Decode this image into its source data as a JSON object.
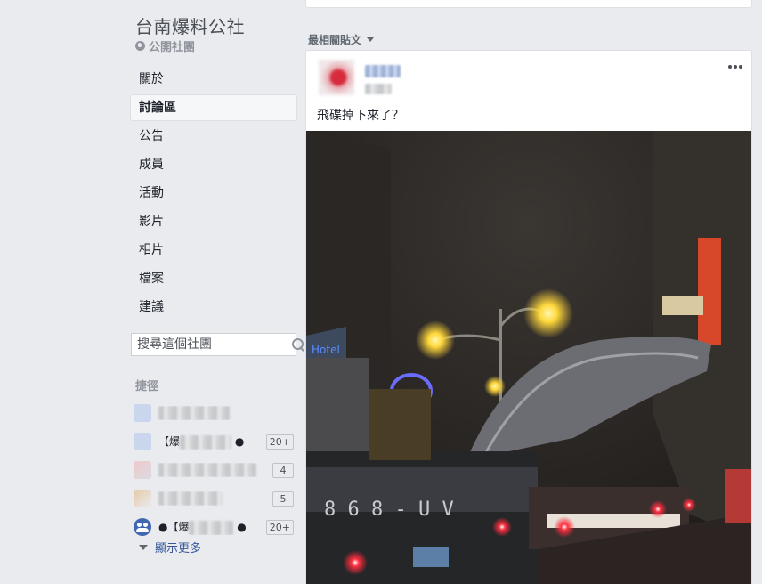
{
  "group": {
    "title": "台南爆料公社",
    "privacy": "公開社團"
  },
  "nav": {
    "items": [
      {
        "label": "關於",
        "active": false
      },
      {
        "label": "討論區",
        "active": true
      },
      {
        "label": "公告",
        "active": false
      },
      {
        "label": "成員",
        "active": false
      },
      {
        "label": "活動",
        "active": false
      },
      {
        "label": "影片",
        "active": false
      },
      {
        "label": "相片",
        "active": false
      },
      {
        "label": "檔案",
        "active": false
      },
      {
        "label": "建議",
        "active": false
      }
    ]
  },
  "search": {
    "placeholder": "搜尋這個社團"
  },
  "shortcuts": {
    "heading": "捷徑",
    "items": [
      {
        "name": "",
        "count": ""
      },
      {
        "name": "【爆",
        "count": "20+"
      },
      {
        "name": "",
        "count": "4"
      },
      {
        "name": "",
        "count": "5"
      },
      {
        "name": "●【爆",
        "count": "20+"
      }
    ],
    "see_more": "顯示更多"
  },
  "feed": {
    "sort_label": "最相關貼文"
  },
  "post": {
    "text": "飛碟掉下來了？"
  },
  "colors": {
    "link": "#365899",
    "background": "#e9ebee",
    "group_icon": "#4267b2"
  }
}
